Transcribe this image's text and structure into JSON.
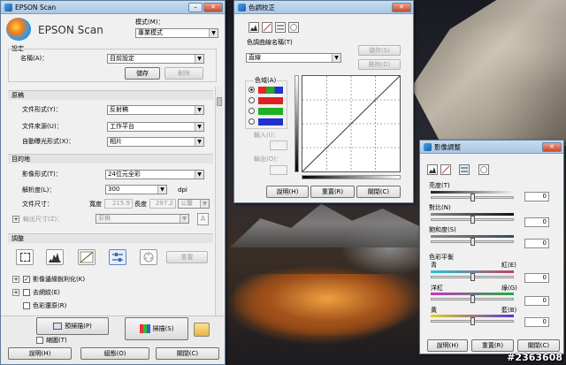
{
  "colors": {
    "title_bar": "#b6d0ea",
    "window_bg": "#f0f0f0",
    "accent": "#1a5fa8"
  },
  "epson": {
    "window_title": "EPSON Scan",
    "logo_text": "EPSON Scan",
    "mode_label": "模式(M)：",
    "mode_value": "專業模式",
    "settings": {
      "header": "設定",
      "name_label": "名稱(A)：",
      "name_value": "目前設定",
      "save_button": "儲存",
      "delete_button": "刪除"
    },
    "original": {
      "header": "原稿",
      "doc_type_label": "文件形式(Y)：",
      "doc_type_value": "反射稿",
      "doc_source_label": "文件來源(U)：",
      "doc_source_value": "工作平台",
      "auto_exposure_label": "自動曝光形式(X)：",
      "auto_exposure_value": "相片"
    },
    "destination": {
      "header": "目的地",
      "image_type_label": "影像形式(T)：",
      "image_type_value": "24位元全彩",
      "resolution_label": "解析度(L)：",
      "resolution_value": "300",
      "resolution_unit": "dpi",
      "doc_size_label": "文件尺寸：",
      "width_label": "寬度",
      "width_value": "215.9",
      "length_label": "長度",
      "length_value": "297.2",
      "size_unit": "公釐",
      "target_size_label": "輸出尺寸(Z)：",
      "target_size_value": "原稿"
    },
    "adjustments": {
      "header": "調整",
      "reset_button": "重置",
      "unsharp_label": "影像邊緣銳利化(K)",
      "descreen_label": "去網紋(E)",
      "color_restore_label": "色彩還原(R)"
    },
    "preview_button": "預掃描(P)",
    "scan_button": "掃描(S)",
    "thumbnail_label": "縮圖(T)",
    "help_button": "說明(H)",
    "config_button": "組態(O)",
    "close_button": "關閉(C)"
  },
  "tone": {
    "window_title": "色調校正",
    "curve_name_label": "色調曲線名稱(T)",
    "curve_name_value": "直線",
    "save_button": "儲存(S)",
    "delete_button": "刪除(D)",
    "channel_label": "色域(A)",
    "input_label": "輸入(I)：",
    "output_label": "輸出(O)：",
    "help_button": "說明(H)",
    "reset_button": "重置(R)",
    "close_button": "關閉(C)"
  },
  "image_adjust": {
    "window_title": "影像調整",
    "brightness_label": "亮度(T)",
    "brightness_value": "0",
    "contrast_label": "對比(N)",
    "contrast_value": "0",
    "saturation_label": "飽和度(S)",
    "saturation_value": "0",
    "color_balance_label": "色彩平衡",
    "cyan_label": "青",
    "red_label": "紅(E)",
    "cr_value": "0",
    "magenta_label": "洋紅",
    "green_label": "綠(G)",
    "mg_value": "0",
    "yellow_label": "黃",
    "blue_label": "藍(B)",
    "yb_value": "0",
    "help_button": "說明(H)",
    "reset_button": "重置(R)",
    "close_button": "關閉(C)"
  },
  "watermark": "#2363608"
}
